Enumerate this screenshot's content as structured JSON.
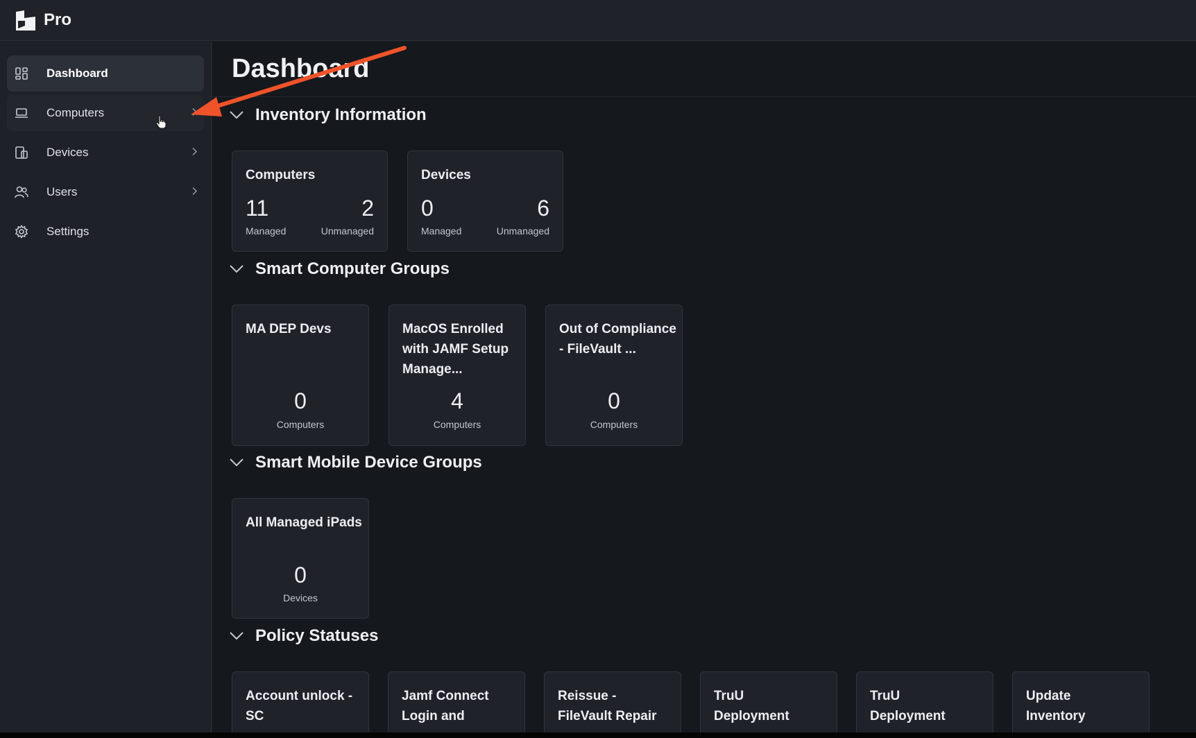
{
  "app": {
    "brand": "Pro"
  },
  "sidebar": {
    "items": [
      {
        "label": "Dashboard",
        "icon": "dashboard-icon"
      },
      {
        "label": "Computers",
        "icon": "laptop-icon"
      },
      {
        "label": "Devices",
        "icon": "devices-icon"
      },
      {
        "label": "Users",
        "icon": "users-icon"
      },
      {
        "label": "Settings",
        "icon": "gear-icon"
      }
    ]
  },
  "main": {
    "title": "Dashboard",
    "inventory": {
      "title": "Inventory Information",
      "cards": [
        {
          "title": "Computers",
          "managed": "11",
          "unmanaged": "2",
          "managed_label": "Managed",
          "unmanaged_label": "Unmanaged"
        },
        {
          "title": "Devices",
          "managed": "0",
          "unmanaged": "6",
          "managed_label": "Managed",
          "unmanaged_label": "Unmanaged"
        }
      ]
    },
    "smart_computer_groups": {
      "title": "Smart Computer Groups",
      "cards": [
        {
          "title": "MA DEP Devs",
          "count": "0",
          "unit": "Computers"
        },
        {
          "title": "MacOS Enrolled with JAMF Setup Manage...",
          "count": "4",
          "unit": "Computers"
        },
        {
          "title": "Out of Compliance - FileVault ...",
          "count": "0",
          "unit": "Computers"
        }
      ]
    },
    "smart_mobile_groups": {
      "title": "Smart Mobile Device Groups",
      "cards": [
        {
          "title": "All Managed iPads",
          "count": "0",
          "unit": "Devices"
        }
      ]
    },
    "policy_statuses": {
      "title": "Policy Statuses",
      "cards": [
        {
          "title": "Account unlock - SC"
        },
        {
          "title": "Jamf Connect Login and"
        },
        {
          "title": "Reissue - FileVault Repair"
        },
        {
          "title": "TruU Deployment"
        },
        {
          "title": "TruU Deployment"
        },
        {
          "title": "Update Inventory"
        }
      ]
    }
  },
  "colors": {
    "annotation_arrow": "#f0532a",
    "background": "#15181d",
    "sidebar": "#1e2127"
  }
}
